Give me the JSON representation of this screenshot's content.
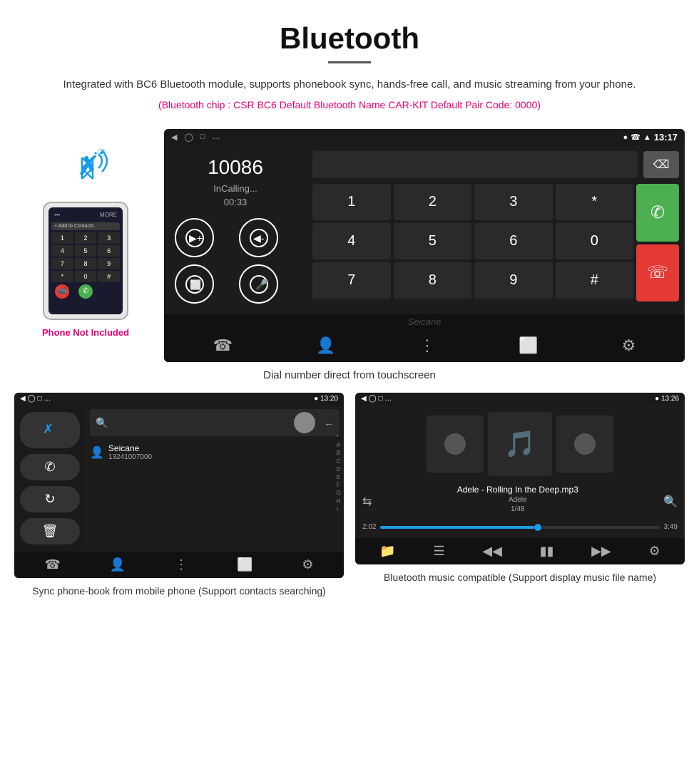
{
  "header": {
    "title": "Bluetooth",
    "description": "Integrated with BC6 Bluetooth module, supports phonebook sync, hands-free call, and music streaming from your phone.",
    "specs": "(Bluetooth chip : CSR BC6    Default Bluetooth Name CAR-KIT    Default Pair Code: 0000)"
  },
  "phone_label": "Phone Not Included",
  "dial_screen": {
    "status_bar": {
      "nav": "◁  ○  □  ▦",
      "icons": "♥  ☎  ◆  13:17",
      "time": "13:17"
    },
    "number": "10086",
    "status": "InCalling...",
    "timer": "00:33",
    "keys": [
      "1",
      "2",
      "3",
      "4",
      "5",
      "6",
      "7",
      "8",
      "9",
      "*",
      "0",
      "#"
    ],
    "watermark": "Seicane"
  },
  "caption_main": "Dial number direct from touchscreen",
  "phonebook_screen": {
    "status_time": "13:20",
    "contact_name": "Seicane",
    "contact_number": "13241007000",
    "alphabet": [
      "*",
      "A",
      "B",
      "C",
      "D",
      "E",
      "F",
      "G",
      "H",
      "I"
    ]
  },
  "music_screen": {
    "status_time": "13:26",
    "song_title": "Adele - Rolling In the Deep.mp3",
    "artist": "Adele",
    "track_info": "1/48",
    "time_current": "2:02",
    "time_total": "3:49"
  },
  "caption_phonebook": "Sync phone-book from mobile phone\n(Support contacts searching)",
  "caption_music": "Bluetooth music compatible\n(Support display music file name)"
}
